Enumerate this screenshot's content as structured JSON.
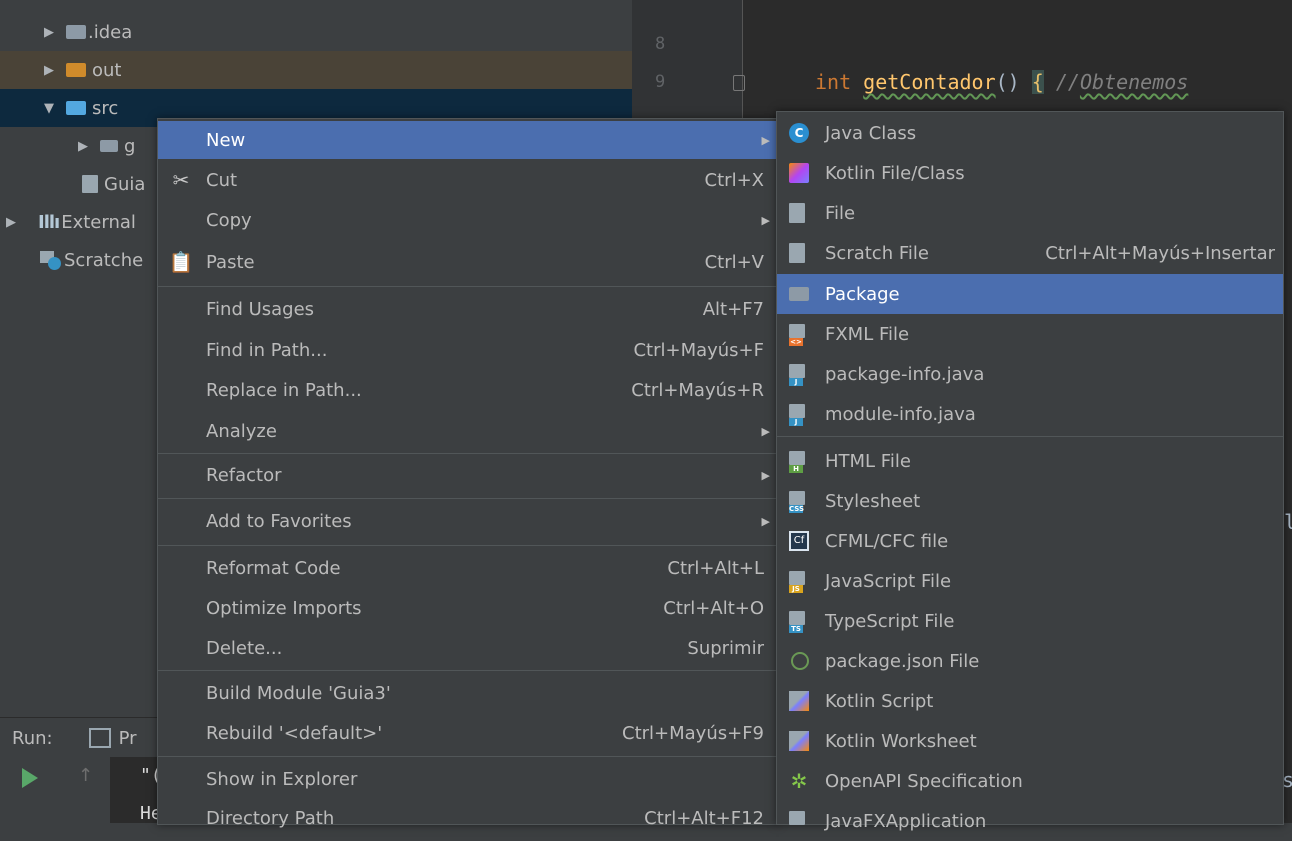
{
  "tree": {
    "items": [
      {
        "label": ".idea"
      },
      {
        "label": "out"
      },
      {
        "label": "src"
      },
      {
        "label": "g"
      },
      {
        "label": "Guia"
      },
      {
        "label": "External"
      },
      {
        "label": "Scratche"
      }
    ]
  },
  "editor": {
    "line_numbers": [
      "8",
      "9"
    ],
    "code_keyword": "int",
    "code_function": "getContador",
    "code_parens": "()",
    "code_brace": "{",
    "code_comment_prefix": "//",
    "code_comment_word": "Obtenemos",
    "right_edge_char_1": "le",
    "right_edge_char_2": "s"
  },
  "run": {
    "label": "Run:",
    "tab_label": "Pr",
    "console_line_1": "\"(",
    "console_line_2": "He"
  },
  "context_menu": {
    "items": [
      {
        "label": "New",
        "shortcut": "",
        "submenu": true
      },
      {
        "label": "Cut",
        "shortcut": "Ctrl+X"
      },
      {
        "label": "Copy",
        "shortcut": "",
        "submenu": true
      },
      {
        "label": "Paste",
        "shortcut": "Ctrl+V"
      },
      {
        "label": "Find Usages",
        "shortcut": "Alt+F7"
      },
      {
        "label": "Find in Path...",
        "shortcut": "Ctrl+Mayús+F"
      },
      {
        "label": "Replace in Path...",
        "shortcut": "Ctrl+Mayús+R"
      },
      {
        "label": "Analyze",
        "shortcut": "",
        "submenu": true
      },
      {
        "label": "Refactor",
        "shortcut": "",
        "submenu": true
      },
      {
        "label": "Add to Favorites",
        "shortcut": "",
        "submenu": true
      },
      {
        "label": "Reformat Code",
        "shortcut": "Ctrl+Alt+L"
      },
      {
        "label": "Optimize Imports",
        "shortcut": "Ctrl+Alt+O"
      },
      {
        "label": "Delete...",
        "shortcut": "Suprimir"
      },
      {
        "label": "Build Module 'Guia3'",
        "shortcut": ""
      },
      {
        "label": "Rebuild '<default>'",
        "shortcut": "Ctrl+Mayús+F9"
      },
      {
        "label": "Show in Explorer",
        "shortcut": ""
      },
      {
        "label": "Directory Path",
        "shortcut": "Ctrl+Alt+F12"
      }
    ]
  },
  "new_submenu": {
    "items": [
      {
        "label": "Java Class",
        "shortcut": ""
      },
      {
        "label": "Kotlin File/Class",
        "shortcut": ""
      },
      {
        "label": "File",
        "shortcut": ""
      },
      {
        "label": "Scratch File",
        "shortcut": "Ctrl+Alt+Mayús+Insertar"
      },
      {
        "label": "Package",
        "shortcut": ""
      },
      {
        "label": "FXML File",
        "shortcut": ""
      },
      {
        "label": "package-info.java",
        "shortcut": ""
      },
      {
        "label": "module-info.java",
        "shortcut": ""
      },
      {
        "label": "HTML File",
        "shortcut": ""
      },
      {
        "label": "Stylesheet",
        "shortcut": ""
      },
      {
        "label": "CFML/CFC file",
        "shortcut": ""
      },
      {
        "label": "JavaScript File",
        "shortcut": ""
      },
      {
        "label": "TypeScript File",
        "shortcut": ""
      },
      {
        "label": "package.json File",
        "shortcut": ""
      },
      {
        "label": "Kotlin Script",
        "shortcut": ""
      },
      {
        "label": "Kotlin Worksheet",
        "shortcut": ""
      },
      {
        "label": "OpenAPI Specification",
        "shortcut": ""
      },
      {
        "label": "JavaFXApplication",
        "shortcut": ""
      }
    ]
  },
  "icon_names": {
    "java_class": "C",
    "cfml": "Cf",
    "css_tag": "CSS",
    "js_tag": "JS",
    "ts_tag": "TS",
    "html_tag": "H",
    "java_tag": "J",
    "fxml_tag": "<>"
  },
  "colors": {
    "highlight": "#4b6eaf",
    "background": "#3c3f41",
    "editor": "#2b2b2b"
  }
}
